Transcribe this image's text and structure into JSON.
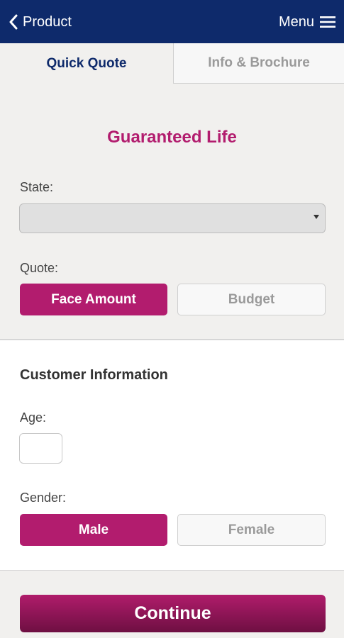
{
  "header": {
    "back_label": "Product",
    "menu_label": "Menu"
  },
  "tabs": [
    {
      "label": "Quick Quote",
      "active": true
    },
    {
      "label": "Info & Brochure",
      "active": false
    }
  ],
  "product": {
    "title": "Guaranteed Life"
  },
  "state": {
    "label": "State:",
    "selected": ""
  },
  "quote": {
    "label": "Quote:",
    "options": [
      {
        "label": "Face Amount",
        "selected": true
      },
      {
        "label": "Budget",
        "selected": false
      }
    ]
  },
  "customer": {
    "heading": "Customer Information",
    "age_label": "Age:",
    "age_value": "",
    "gender_label": "Gender:",
    "gender_options": [
      {
        "label": "Male",
        "selected": true
      },
      {
        "label": "Female",
        "selected": false
      }
    ]
  },
  "actions": {
    "continue_label": "Continue"
  },
  "colors": {
    "header_bg": "#0e2a6b",
    "accent": "#b21c6e",
    "tab_active_text": "#0e2a6b"
  }
}
